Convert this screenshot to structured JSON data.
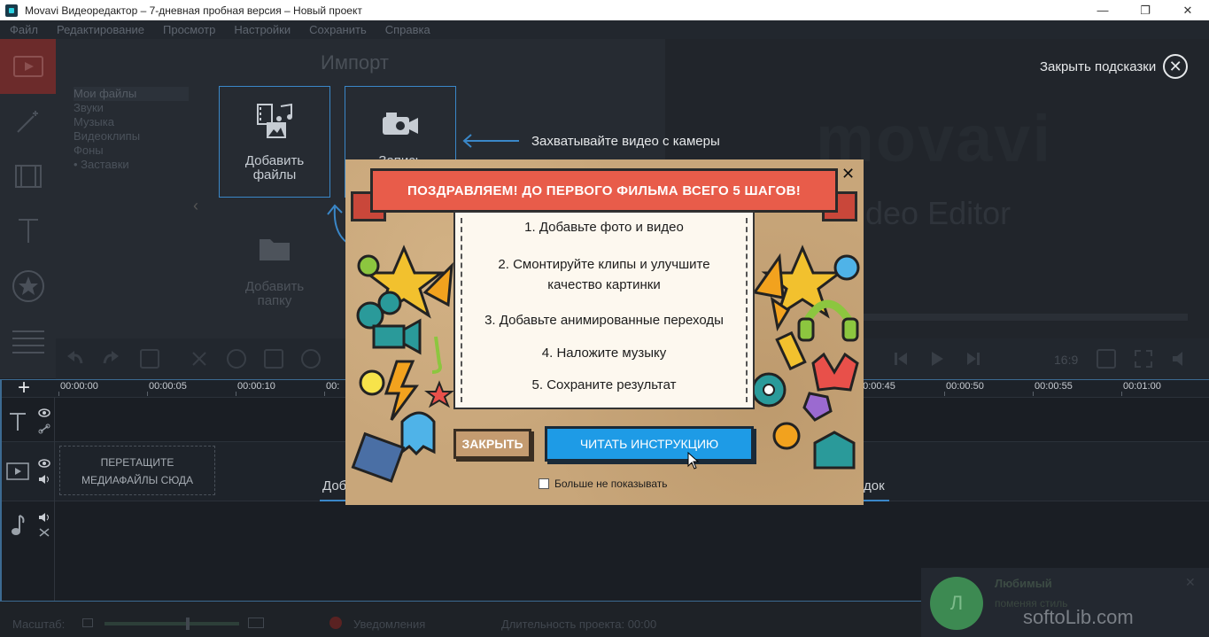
{
  "window": {
    "title": "Movavi Видеоредактор – 7-дневная пробная версия – Новый проект",
    "minimize": "—",
    "restore": "❐",
    "close": "✕"
  },
  "menu": [
    "Файл",
    "Редактирование",
    "Просмотр",
    "Настройки",
    "Сохранить",
    "Справка"
  ],
  "import": {
    "title": "Импорт",
    "categories": [
      "Мои файлы",
      "Звуки",
      "Музыка",
      "Видеоклипы",
      "Фоны",
      "• Заставки"
    ],
    "add_files": "Добавить файлы",
    "add_files_l1": "Добавить",
    "add_files_l2": "файлы",
    "record_l1": "Запись",
    "add_folder_l1": "Добавить",
    "add_folder_l2": "папку"
  },
  "hints": {
    "close_hints": "Закрыть подсказки",
    "capture_camera": "Захватывайте видео с камеры"
  },
  "preview": {
    "brand": "movavi",
    "brand_sub": "deo Editor"
  },
  "toolbar": {
    "ratio": "16:9"
  },
  "timeline": {
    "ruler": [
      "00:00:00",
      "00:00:05",
      "00:00:10",
      "00:",
      "00:00:45",
      "00:00:50",
      "00:00:55",
      "00:01:00"
    ],
    "drop_l1": "ПЕРЕТАЩИТЕ",
    "drop_l2": "МЕДИАФАЙЛЫ СЮДА",
    "behind_left": "Доб",
    "behind_right": "док"
  },
  "status": {
    "scale": "Масштаб:",
    "notifications": "Уведомления",
    "duration": "Длительность проекта:  00:00"
  },
  "notification": {
    "avatar": "Л",
    "title": "Любимый",
    "text": "поменяя стиль"
  },
  "watermark": "softoLib.com",
  "modal": {
    "ribbon": "ПОЗДРАВЛЯЕМ! ДО ПЕРВОГО ФИЛЬМА ВСЕГО 5 ШАГОВ!",
    "close": "✕",
    "steps": [
      "1. Добавьте фото и видео",
      "2. Смонтируйте клипы и улучшите",
      "качество картинки",
      "3. Добавьте анимированные переходы",
      "4. Наложите музыку",
      "5. Сохраните результат"
    ],
    "btn_close": "ЗАКРЫТЬ",
    "btn_read": "ЧИТАТЬ ИНСТРУКЦИЮ",
    "dont_show": "Больше не показывать"
  },
  "colors": {
    "accent": "#1e9be6",
    "ribbon": "#e85c4a",
    "active_tab": "#6c2b2b",
    "timeline_line": "#3c6a91"
  }
}
